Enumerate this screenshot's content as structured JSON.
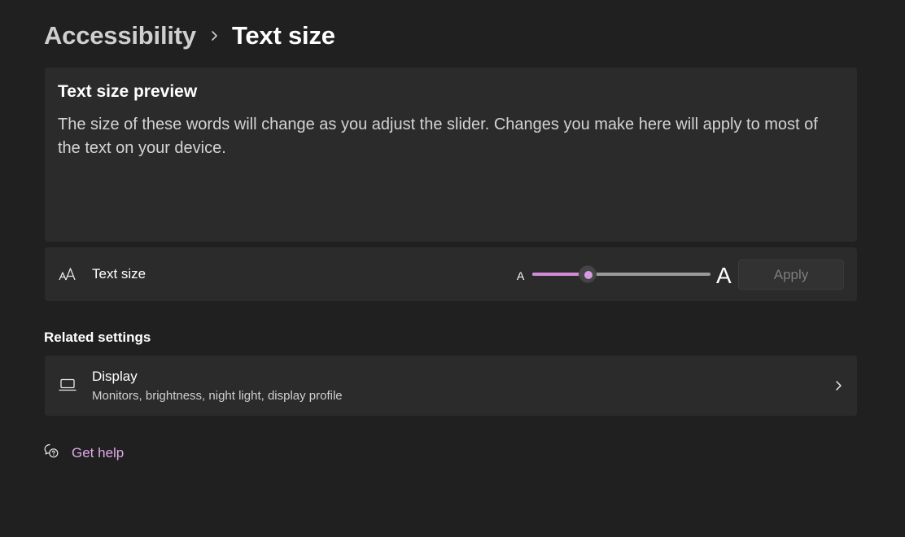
{
  "breadcrumb": {
    "parent": "Accessibility",
    "separator_icon": "chevron-right-icon",
    "current": "Text size"
  },
  "preview": {
    "title": "Text size preview",
    "body": "The size of these words will change as you adjust the slider. Changes you make here will apply to most of the text on your device."
  },
  "text_size_setting": {
    "icon": "font-size-icon",
    "label": "Text size",
    "small_label": "A",
    "large_label": "A",
    "slider_value_fraction": 0.31,
    "apply_label": "Apply"
  },
  "related_settings": {
    "heading": "Related settings",
    "items": [
      {
        "icon": "laptop-icon",
        "title": "Display",
        "subtitle": "Monitors, brightness, night light, display profile",
        "chevron": "chevron-right-icon"
      }
    ]
  },
  "help": {
    "icon": "help-chat-icon",
    "label": "Get help"
  },
  "colors": {
    "background": "#202020",
    "card": "#2b2b2b",
    "accent": "#d08ad6",
    "link": "#e0a8e8"
  }
}
